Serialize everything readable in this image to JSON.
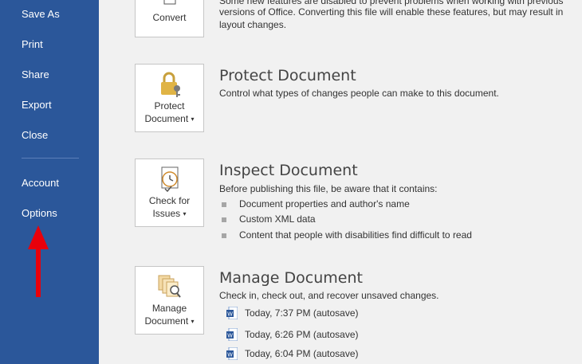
{
  "sidebar": {
    "items": [
      {
        "label": "Save As"
      },
      {
        "label": "Print"
      },
      {
        "label": "Share"
      },
      {
        "label": "Export"
      },
      {
        "label": "Close"
      },
      {
        "label": "Account"
      },
      {
        "label": "Options"
      }
    ]
  },
  "convert": {
    "button_label": "Convert",
    "desc_line1": "Some new features are disabled to prevent problems when working with previous",
    "desc_line2": "versions of Office. Converting this file will enable these features, but may result in",
    "desc_line3": "layout changes."
  },
  "protect": {
    "button_line1": "Protect",
    "button_line2": "Document",
    "title": "Protect Document",
    "desc": "Control what types of changes people can make to this document."
  },
  "inspect": {
    "button_line1": "Check for",
    "button_line2": "Issues",
    "title": "Inspect Document",
    "desc": "Before publishing this file, be aware that it contains:",
    "bullets": [
      "Document properties and author's name",
      "Custom XML data",
      "Content that people with disabilities find difficult to read"
    ]
  },
  "manage": {
    "button_line1": "Manage",
    "button_line2": "Document",
    "title": "Manage Document",
    "desc": "Check in, check out, and recover unsaved changes.",
    "versions": [
      "Today, 7:37 PM (autosave)",
      "Today, 6:26 PM (autosave)",
      "Today, 6:04 PM (autosave)"
    ]
  },
  "colors": {
    "sidebar": "#2b579a",
    "arrow": "#e8000b",
    "main_bg": "#f1f1f1"
  },
  "icons": {
    "protect": "lock-key-icon",
    "inspect": "checklist-inspect-icon",
    "manage": "documents-search-icon",
    "version": "word-doc-icon",
    "annotation": "red-up-arrow-icon"
  }
}
